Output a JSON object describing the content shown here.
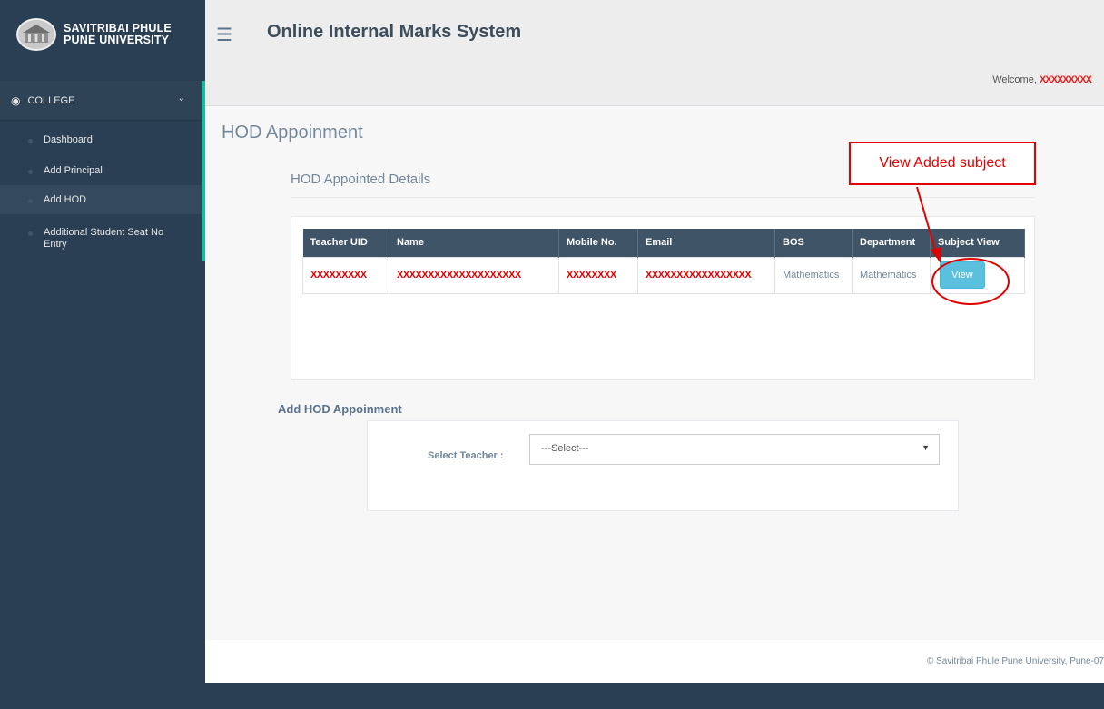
{
  "sidebar": {
    "logo_line1": "SAVITRIBAI PHULE",
    "logo_line2": "PUNE UNIVERSITY",
    "group_label": "COLLEGE",
    "items": [
      {
        "label": "Dashboard"
      },
      {
        "label": "Add Principal"
      },
      {
        "label": "Add HOD"
      },
      {
        "label": "Additional Student Seat No Entry"
      }
    ]
  },
  "header": {
    "title": "Online Internal Marks System",
    "welcome_prefix": "Welcome,",
    "welcome_name": "XXXXXXXXX"
  },
  "main": {
    "page_title": "HOD Appoinment",
    "section_title": "HOD Appointed Details",
    "table": {
      "headers": [
        "Teacher UID",
        "Name",
        "Mobile No.",
        "Email",
        "BOS",
        "Department",
        "Subject View"
      ],
      "row": {
        "teacher_uid": "XXXXXXXXX",
        "name": "XXXXXXXXXXXXXXXXXXXX",
        "mobile": "XXXXXXXX",
        "email": "XXXXXXXXXXXXXXXXX",
        "bos": "Mathematics",
        "department": "Mathematics",
        "view_label": "View"
      }
    },
    "add_title": "Add HOD Appoinment",
    "select_label": "Select Teacher :",
    "select_value": "---Select---"
  },
  "footer": {
    "text": "© Savitribai Phule Pune University, Pune-07"
  },
  "annotation": {
    "label": "View Added subject",
    "color": "#e10000"
  },
  "colors": {
    "sidebar_bg": "#2a3f54",
    "accent": "#1abb9c",
    "table_header": "#405467",
    "info_button": "#5bc0de"
  }
}
